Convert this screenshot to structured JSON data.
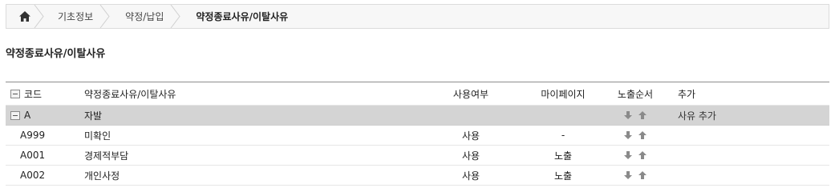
{
  "breadcrumb": {
    "home_icon": "home-icon",
    "items": [
      "기초정보",
      "약정/납입",
      "약정종료사유/이탈사유"
    ]
  },
  "page_title": "약정종료사유/이탈사유",
  "table": {
    "headers": {
      "code": "코드",
      "name": "약정종료사유/이탈사유",
      "use": "사용여부",
      "mypage": "마이페이지",
      "order": "노출순서",
      "add": "추가"
    },
    "group": {
      "code": "A",
      "name": "자발",
      "add_label": "사유 추가"
    },
    "rows": [
      {
        "code": "A999",
        "name": "미확인",
        "use": "사용",
        "mypage": "-"
      },
      {
        "code": "A001",
        "name": "경제적부담",
        "use": "사용",
        "mypage": "노출"
      },
      {
        "code": "A002",
        "name": "개인사정",
        "use": "사용",
        "mypage": "노출"
      }
    ]
  },
  "colors": {
    "group_row_bg": "#d4d4d4",
    "arrow": "#8a8a8a",
    "breadcrumb_bg": "#f7f7f7"
  }
}
